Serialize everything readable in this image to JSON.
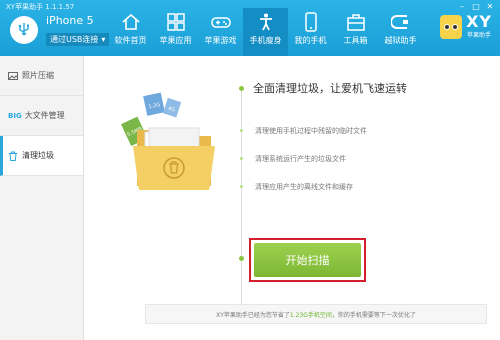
{
  "window": {
    "title": "XY苹果助手 1.1.1.57",
    "controls": [
      "minimize",
      "maximize",
      "close"
    ]
  },
  "device": {
    "name": "iPhone 5",
    "connection": "通过USB连接",
    "icon": "usb-icon"
  },
  "nav": {
    "items": [
      {
        "label": "软件首页",
        "icon": "home-icon",
        "active": false
      },
      {
        "label": "苹果应用",
        "icon": "apps-grid-icon",
        "active": false
      },
      {
        "label": "苹果游戏",
        "icon": "gamepad-icon",
        "active": false
      },
      {
        "label": "手机瘦身",
        "icon": "slim-figure-icon",
        "active": true
      },
      {
        "label": "我的手机",
        "icon": "phone-icon",
        "active": false
      },
      {
        "label": "工具箱",
        "icon": "toolbox-icon",
        "active": false
      },
      {
        "label": "越狱助手",
        "icon": "jailbreak-icon",
        "active": false
      }
    ]
  },
  "brand": {
    "name": "XY",
    "subtitle": "苹果助手"
  },
  "sidebar": {
    "items": [
      {
        "label": "照片压缩",
        "icon": "photo-icon",
        "active": false
      },
      {
        "label": "大文件管理",
        "badge": "BIG",
        "active": false
      },
      {
        "label": "清理垃圾",
        "icon": "trash-icon",
        "active": true
      }
    ]
  },
  "main": {
    "headline": "全面清理垃圾，让爱机飞速运转",
    "steps": [
      "清理使用手机过程中残留的临时文件",
      "清理系统运行产生的垃圾文件",
      "清理应用产生的离线文件和缓存"
    ],
    "scan_button": "开始扫描",
    "footer": {
      "prefix": "XY苹果助手已经为您节省了",
      "amount": "1.23G手机空间",
      "suffix": "，你的手机需要等下一次优化了"
    },
    "folder_tags": [
      "1.2G",
      "4G",
      "5.5MB"
    ],
    "colors": {
      "accent": "#2aa6dd",
      "button_green": "#8cc63e",
      "highlight_red": "#d51e2b",
      "folder_yellow": "#f4cf63"
    }
  }
}
